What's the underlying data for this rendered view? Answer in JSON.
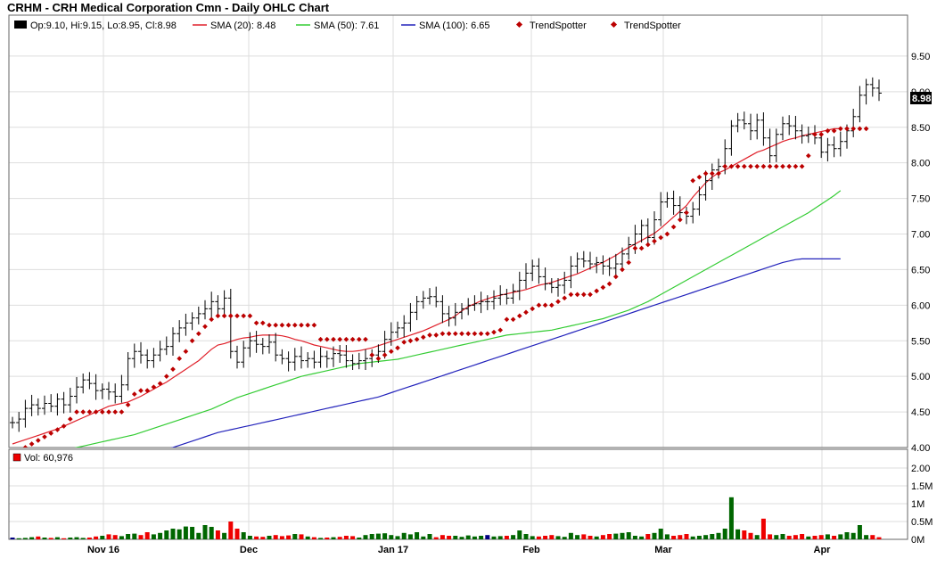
{
  "title": "CRHM - CRH Medical Corporation Cmn - Daily OHLC Chart",
  "legend": {
    "ohlc": "Op:9.10, Hi:9.15, Lo:8.95, Cl:8.98",
    "sma20": "SMA (20): 8.48",
    "sma50": "SMA (50): 7.61",
    "sma100": "SMA (100): 6.65",
    "trend1": "TrendSpotter",
    "trend2": "TrendSpotter",
    "volume": "Vol: 60,976"
  },
  "colors": {
    "sma20": "#e0202a",
    "sma50": "#33cc33",
    "sma100": "#2222bb",
    "trend": "#bb0000",
    "vol_up": "#006600",
    "vol_down": "#ee0000",
    "vol_neutral": "#000080",
    "grid": "#dddddd",
    "frame": "#666666"
  },
  "last_price_label": "8.98",
  "chart_data": {
    "type": "ohlc",
    "x_tick_labels": [
      "Nov 16",
      "Dec",
      "Jan 17",
      "Feb",
      "Mar",
      "Apr"
    ],
    "y_tick_labels": [
      "4.00",
      "4.50",
      "5.00",
      "5.50",
      "6.00",
      "6.50",
      "7.00",
      "7.50",
      "8.00",
      "8.50",
      "9.00",
      "9.50"
    ],
    "ylim": [
      4.0,
      9.9
    ],
    "volume_tick_labels": [
      "0M",
      "0.5M",
      "1M",
      "1.5M",
      "2.00"
    ],
    "volume_ylim": [
      0,
      2.0
    ],
    "closes": [
      4.35,
      4.4,
      4.55,
      4.6,
      4.55,
      4.62,
      4.58,
      4.68,
      4.6,
      4.72,
      4.85,
      4.95,
      4.9,
      4.8,
      4.82,
      4.78,
      4.72,
      4.88,
      5.25,
      5.35,
      5.3,
      5.22,
      5.3,
      5.38,
      5.42,
      5.6,
      5.68,
      5.75,
      5.82,
      5.88,
      5.95,
      6.05,
      5.95,
      6.1,
      5.35,
      5.2,
      5.4,
      5.5,
      5.45,
      5.42,
      5.48,
      5.3,
      5.25,
      5.2,
      5.28,
      5.22,
      5.25,
      5.2,
      5.28,
      5.25,
      5.32,
      5.3,
      5.22,
      5.18,
      5.22,
      5.25,
      5.3,
      5.35,
      5.52,
      5.62,
      5.68,
      5.75,
      5.9,
      6.05,
      6.1,
      6.12,
      6.05,
      5.88,
      5.82,
      5.9,
      5.95,
      6.0,
      6.02,
      6.05,
      6.05,
      6.1,
      6.15,
      6.1,
      6.2,
      6.35,
      6.45,
      6.55,
      6.4,
      6.3,
      6.25,
      6.28,
      6.35,
      6.55,
      6.65,
      6.62,
      6.58,
      6.6,
      6.55,
      6.52,
      6.58,
      6.72,
      6.85,
      7.0,
      7.12,
      6.95,
      7.2,
      7.45,
      7.5,
      7.4,
      7.3,
      7.25,
      7.35,
      7.55,
      7.75,
      7.9,
      7.95,
      8.2,
      8.52,
      8.6,
      8.55,
      8.45,
      8.6,
      8.35,
      8.1,
      8.4,
      8.55,
      8.52,
      8.45,
      8.38,
      8.4,
      8.35,
      8.15,
      8.25,
      8.2,
      8.3,
      8.45,
      8.65,
      8.95,
      9.1,
      9.05,
      8.98
    ],
    "sma20": [
      4.05,
      4.08,
      4.11,
      4.14,
      4.17,
      4.2,
      4.23,
      4.26,
      4.3,
      4.34,
      4.38,
      4.42,
      4.46,
      4.5,
      4.54,
      4.58,
      4.6,
      4.62,
      4.64,
      4.68,
      4.72,
      4.77,
      4.82,
      4.87,
      4.92,
      4.98,
      5.04,
      5.1,
      5.16,
      5.22,
      5.3,
      5.38,
      5.44,
      5.46,
      5.49,
      5.52,
      5.54,
      5.55,
      5.57,
      5.58,
      5.58,
      5.58,
      5.57,
      5.55,
      5.52,
      5.5,
      5.47,
      5.44,
      5.42,
      5.4,
      5.38,
      5.36,
      5.35,
      5.35,
      5.36,
      5.38,
      5.4,
      5.43,
      5.46,
      5.49,
      5.52,
      5.55,
      5.58,
      5.61,
      5.64,
      5.68,
      5.72,
      5.76,
      5.8,
      5.85,
      5.92,
      5.98,
      6.02,
      6.06,
      6.09,
      6.12,
      6.14,
      6.16,
      6.18,
      6.2,
      6.22,
      6.25,
      6.28,
      6.3,
      6.32,
      6.35,
      6.38,
      6.41,
      6.44,
      6.48,
      6.52,
      6.56,
      6.6,
      6.65,
      6.7,
      6.76,
      6.81,
      6.86,
      6.91,
      6.96,
      7.01,
      7.08,
      7.16,
      7.24,
      7.32,
      7.4,
      7.52,
      7.62,
      7.72,
      7.8,
      7.86,
      7.9,
      7.95,
      8.0,
      8.05,
      8.1,
      8.15,
      8.18,
      8.22,
      8.26,
      8.3,
      8.33,
      8.35,
      8.38,
      8.4,
      8.42,
      8.44,
      8.46,
      8.48,
      8.48
    ],
    "sma50": [
      3.8,
      3.82,
      3.84,
      3.86,
      3.88,
      3.9,
      3.92,
      3.94,
      3.96,
      3.98,
      4.0,
      4.02,
      4.04,
      4.06,
      4.08,
      4.1,
      4.12,
      4.14,
      4.16,
      4.18,
      4.21,
      4.24,
      4.27,
      4.3,
      4.33,
      4.36,
      4.39,
      4.42,
      4.45,
      4.48,
      4.51,
      4.54,
      4.58,
      4.62,
      4.66,
      4.7,
      4.73,
      4.76,
      4.79,
      4.82,
      4.85,
      4.88,
      4.91,
      4.94,
      4.97,
      5.0,
      5.02,
      5.04,
      5.06,
      5.08,
      5.1,
      5.12,
      5.14,
      5.16,
      5.18,
      5.19,
      5.2,
      5.21,
      5.22,
      5.23,
      5.24,
      5.26,
      5.28,
      5.3,
      5.32,
      5.34,
      5.36,
      5.38,
      5.4,
      5.42,
      5.44,
      5.46,
      5.48,
      5.5,
      5.52,
      5.54,
      5.56,
      5.58,
      5.59,
      5.6,
      5.61,
      5.62,
      5.63,
      5.64,
      5.65,
      5.67,
      5.69,
      5.71,
      5.73,
      5.75,
      5.77,
      5.79,
      5.81,
      5.84,
      5.87,
      5.9,
      5.93,
      5.97,
      6.01,
      6.05,
      6.1,
      6.15,
      6.2,
      6.25,
      6.3,
      6.35,
      6.4,
      6.45,
      6.5,
      6.55,
      6.6,
      6.65,
      6.7,
      6.75,
      6.8,
      6.85,
      6.9,
      6.95,
      7.0,
      7.05,
      7.1,
      7.15,
      7.2,
      7.25,
      7.3,
      7.36,
      7.42,
      7.48,
      7.54,
      7.61
    ],
    "sma100": [
      3.5,
      3.52,
      3.54,
      3.56,
      3.58,
      3.6,
      3.62,
      3.64,
      3.66,
      3.68,
      3.7,
      3.72,
      3.74,
      3.76,
      3.78,
      3.8,
      3.82,
      3.84,
      3.86,
      3.88,
      3.9,
      3.92,
      3.94,
      3.96,
      3.98,
      4.0,
      4.03,
      4.06,
      4.09,
      4.12,
      4.15,
      4.18,
      4.21,
      4.23,
      4.25,
      4.27,
      4.29,
      4.31,
      4.33,
      4.35,
      4.37,
      4.39,
      4.41,
      4.43,
      4.45,
      4.47,
      4.49,
      4.51,
      4.53,
      4.55,
      4.57,
      4.59,
      4.61,
      4.63,
      4.65,
      4.67,
      4.69,
      4.71,
      4.74,
      4.77,
      4.8,
      4.83,
      4.86,
      4.89,
      4.92,
      4.95,
      4.98,
      5.01,
      5.04,
      5.07,
      5.1,
      5.13,
      5.16,
      5.19,
      5.22,
      5.25,
      5.28,
      5.31,
      5.34,
      5.37,
      5.4,
      5.43,
      5.46,
      5.49,
      5.52,
      5.55,
      5.58,
      5.61,
      5.64,
      5.67,
      5.7,
      5.73,
      5.76,
      5.79,
      5.82,
      5.85,
      5.88,
      5.91,
      5.94,
      5.97,
      6.0,
      6.03,
      6.06,
      6.09,
      6.12,
      6.15,
      6.18,
      6.21,
      6.24,
      6.27,
      6.3,
      6.33,
      6.36,
      6.39,
      6.42,
      6.45,
      6.48,
      6.51,
      6.54,
      6.57,
      6.6,
      6.62,
      6.64,
      6.65,
      6.65,
      6.65,
      6.65,
      6.65,
      6.65,
      6.65
    ],
    "trend": [
      3.9,
      3.95,
      4.0,
      4.05,
      4.1,
      4.15,
      4.2,
      4.25,
      4.3,
      4.4,
      4.5,
      4.5,
      4.5,
      4.5,
      4.5,
      4.5,
      4.5,
      4.5,
      4.6,
      4.75,
      4.8,
      4.8,
      4.85,
      4.9,
      5.0,
      5.1,
      5.25,
      5.35,
      5.5,
      5.6,
      5.7,
      5.8,
      5.85,
      5.85,
      5.85,
      5.85,
      5.85,
      5.85,
      5.75,
      5.75,
      5.72,
      5.72,
      5.72,
      5.72,
      5.72,
      5.72,
      5.72,
      5.72,
      5.52,
      5.52,
      5.52,
      5.52,
      5.52,
      5.52,
      5.52,
      5.52,
      5.3,
      5.25,
      5.3,
      5.35,
      5.4,
      5.48,
      5.5,
      5.52,
      5.55,
      5.58,
      5.58,
      5.6,
      5.6,
      5.6,
      5.6,
      5.6,
      5.6,
      5.6,
      5.6,
      5.62,
      5.65,
      5.8,
      5.8,
      5.85,
      5.9,
      5.95,
      6.0,
      6.0,
      6.0,
      6.05,
      6.1,
      6.15,
      6.15,
      6.15,
      6.15,
      6.2,
      6.25,
      6.3,
      6.4,
      6.5,
      6.6,
      6.8,
      6.8,
      6.85,
      6.9,
      6.95,
      7.0,
      7.1,
      7.2,
      7.3,
      7.75,
      7.8,
      7.85,
      7.85,
      7.85,
      7.95,
      7.95,
      7.95,
      7.95,
      7.95,
      7.95,
      7.95,
      7.95,
      7.95,
      7.95,
      7.95,
      7.95,
      7.95,
      8.1,
      8.4,
      8.4,
      8.45,
      8.45,
      8.48,
      8.48,
      8.48,
      8.48,
      8.48
    ],
    "volumes": [
      0.05,
      0.03,
      0.04,
      0.06,
      0.08,
      0.05,
      0.04,
      0.06,
      0.03,
      0.05,
      0.06,
      0.04,
      0.05,
      0.08,
      0.1,
      0.14,
      0.12,
      0.09,
      0.15,
      0.16,
      0.12,
      0.2,
      0.14,
      0.18,
      0.25,
      0.3,
      0.28,
      0.36,
      0.35,
      0.18,
      0.4,
      0.35,
      0.25,
      0.18,
      0.5,
      0.3,
      0.2,
      0.1,
      0.08,
      0.07,
      0.1,
      0.12,
      0.09,
      0.11,
      0.15,
      0.14,
      0.08,
      0.06,
      0.04,
      0.05,
      0.06,
      0.07,
      0.1,
      0.09,
      0.05,
      0.12,
      0.15,
      0.16,
      0.17,
      0.12,
      0.09,
      0.18,
      0.14,
      0.2,
      0.08,
      0.15,
      0.06,
      0.12,
      0.1,
      0.1,
      0.07,
      0.11,
      0.08,
      0.1,
      0.12,
      0.08,
      0.09,
      0.1,
      0.12,
      0.25,
      0.15,
      0.09,
      0.08,
      0.1,
      0.12,
      0.09,
      0.07,
      0.18,
      0.12,
      0.14,
      0.1,
      0.08,
      0.12,
      0.15,
      0.16,
      0.18,
      0.2,
      0.1,
      0.08,
      0.15,
      0.18,
      0.3,
      0.14,
      0.1,
      0.12,
      0.15,
      0.08,
      0.1,
      0.12,
      0.15,
      0.18,
      0.3,
      1.18,
      0.28,
      0.25,
      0.18,
      0.12,
      0.58,
      0.14,
      0.12,
      0.15,
      0.1,
      0.12,
      0.15,
      0.08,
      0.1,
      0.12,
      0.14,
      0.1,
      0.14,
      0.2,
      0.18,
      0.4,
      0.12,
      0.12,
      0.06
    ]
  }
}
